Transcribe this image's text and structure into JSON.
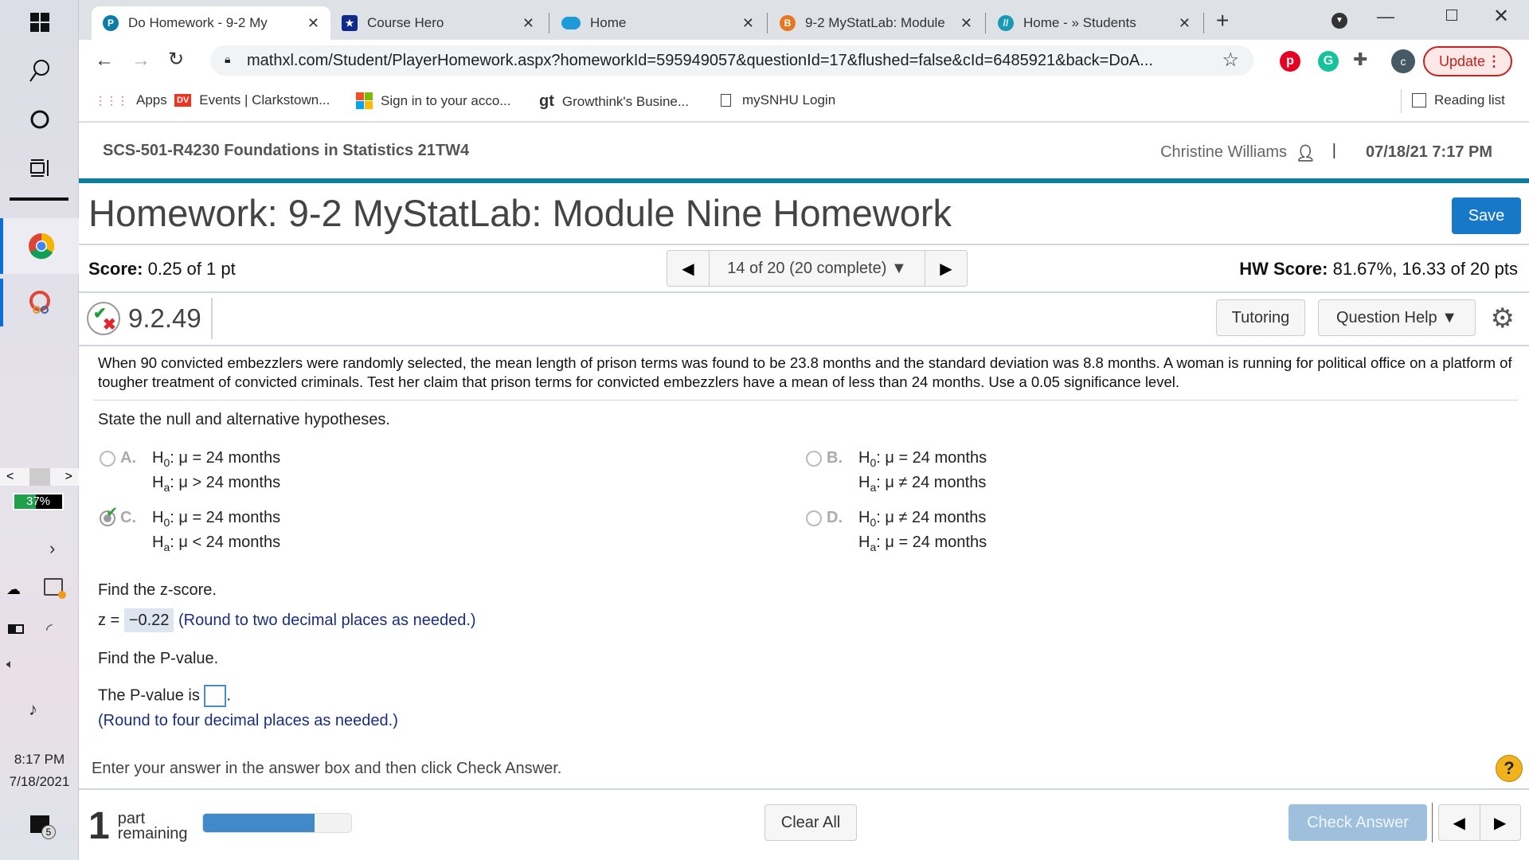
{
  "browser": {
    "tabs": [
      {
        "title": "Do Homework - 9-2 My",
        "icon": "pearson-icon",
        "active": true
      },
      {
        "title": "Course Hero",
        "icon": "course-hero-icon",
        "active": false
      },
      {
        "title": "Home",
        "icon": "salesforce-cloud-icon",
        "active": false
      },
      {
        "title": "9-2 MyStatLab: Module",
        "icon": "brightspace-icon",
        "active": false
      },
      {
        "title": "Home - » Students",
        "icon": "students-site-icon",
        "active": false
      }
    ],
    "url": "mathxl.com/Student/PlayerHomework.aspx?homeworkId=595949057&questionId=17&flushed=false&cId=6485921&back=DoA...",
    "update_label": "Update",
    "profile_initial": "c",
    "bookmarks": [
      {
        "label": "Apps",
        "icon": "apps-grid-icon"
      },
      {
        "label": "Events | Clarkstown...",
        "icon": "dv-icon"
      },
      {
        "label": "Sign in to your acco...",
        "icon": "microsoft-icon"
      },
      {
        "label": "Growthink's Busine...",
        "icon": "gt-icon"
      },
      {
        "label": "mySNHU Login",
        "icon": "document-icon"
      }
    ],
    "reading_list": "Reading list"
  },
  "taskbar": {
    "battery_percent_label": "37%",
    "time": "8:17 PM",
    "date": "7/18/2021",
    "notifications": "5"
  },
  "header": {
    "course": "SCS-501-R4230 Foundations in Statistics 21TW4",
    "user": "Christine Williams",
    "datetime": "07/18/21 7:17 PM"
  },
  "homework": {
    "title": "Homework: 9-2 MyStatLab: Module Nine Homework",
    "save_label": "Save",
    "score_label": "Score:",
    "score_value": "0.25 of 1 pt",
    "nav_label": "14 of 20 (20 complete)",
    "hw_score_label": "HW Score:",
    "hw_score_value": "81.67%, 16.33 of 20 pts"
  },
  "question": {
    "number": "9.2.49",
    "tutoring_label": "Tutoring",
    "help_label": "Question Help",
    "text": "When 90 convicted embezzlers were randomly selected, the mean length of prison terms was found to be 23.8 months and the standard deviation was 8.8 months. A woman is running for political office on a platform of tougher treatment of convicted criminals. Test her claim that prison terms for convicted embezzlers have a mean of less than 24 months. Use a 0.05 significance level.",
    "part1_prompt": "State the null and alternative hypotheses.",
    "choices": [
      {
        "letter": "A.",
        "h0": ": μ = 24 months",
        "ha": ": μ > 24 months",
        "selected": false
      },
      {
        "letter": "B.",
        "h0": ": μ = 24 months",
        "ha": ": μ ≠ 24 months",
        "selected": false
      },
      {
        "letter": "C.",
        "h0": ": μ = 24 months",
        "ha": ": μ < 24 months",
        "selected": true
      },
      {
        "letter": "D.",
        "h0": ": μ ≠ 24 months",
        "ha": ": μ = 24 months",
        "selected": false
      }
    ],
    "part2_prompt": "Find the z-score.",
    "z_label": "z =",
    "z_value": "−0.22",
    "z_hint": "(Round to two decimal places as needed.)",
    "part3_prompt": "Find the P-value.",
    "p_label": "The P-value is",
    "p_value": "",
    "p_hint": "(Round to four decimal places as needed.)"
  },
  "footer": {
    "instruction": "Enter your answer in the answer box and then click Check Answer.",
    "parts_remaining": "1",
    "parts_label_1": "part",
    "parts_label_2": "remaining",
    "progress_fraction": 0.75,
    "clear_label": "Clear All",
    "check_label": "Check Answer"
  }
}
